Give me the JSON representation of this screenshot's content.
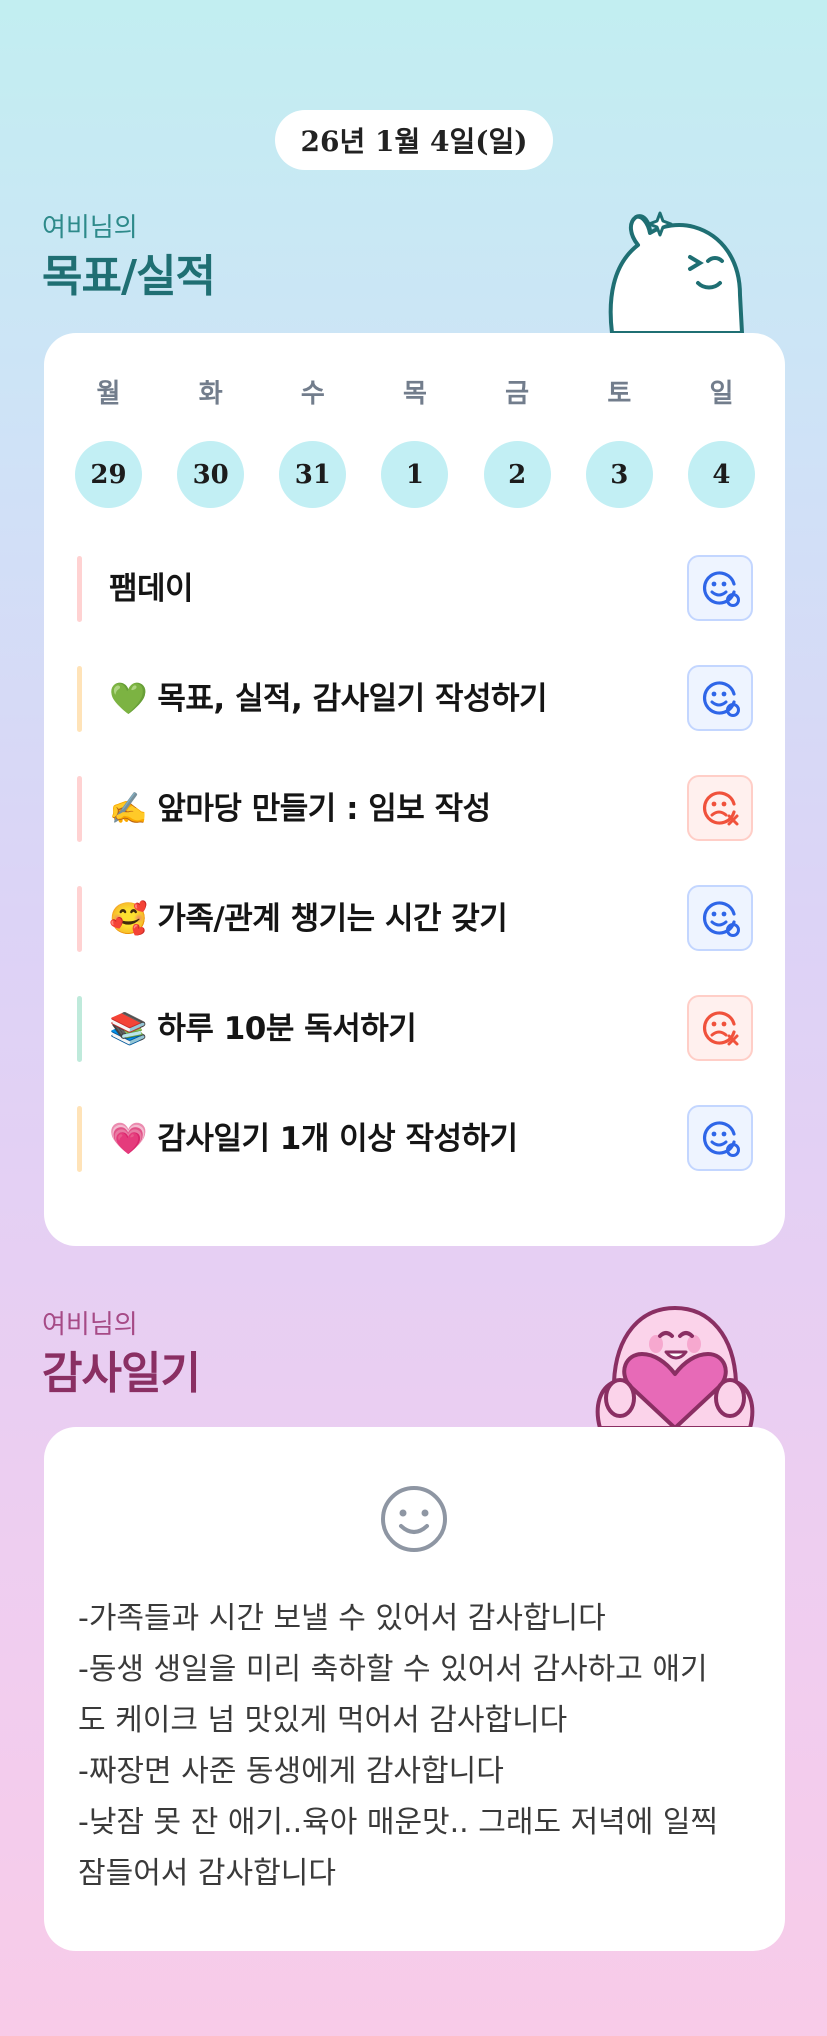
{
  "date": "26년 1월 4일(일)",
  "goals_section": {
    "subtitle": "여비님의",
    "title": "목표/실적"
  },
  "weekdays": [
    "월",
    "화",
    "수",
    "목",
    "금",
    "토",
    "일"
  ],
  "dates": [
    "29",
    "30",
    "31",
    "1",
    "2",
    "3",
    "4"
  ],
  "goals": [
    {
      "label": "팸데이",
      "status": "done",
      "bar_color": "#ffd2d2"
    },
    {
      "label": "💚 목표, 실적, 감사일기 작성하기",
      "status": "done",
      "bar_color": "#ffe3b8"
    },
    {
      "label": "✍️ 앞마당 만들기 : 임보 작성",
      "status": "missed",
      "bar_color": "#ffd2d2"
    },
    {
      "label": "🥰 가족/관계 챙기는 시간 갖기",
      "status": "done",
      "bar_color": "#ffd2d2"
    },
    {
      "label": "📚 하루 10분 독서하기",
      "status": "missed",
      "bar_color": "#bfeadb"
    },
    {
      "label": "💗 감사일기 1개 이상 작성하기",
      "status": "done",
      "bar_color": "#ffe3b8"
    }
  ],
  "gratitude_section": {
    "subtitle": "여비님의",
    "title": "감사일기"
  },
  "gratitude_lines": [
    "-가족들과 시간 보낼 수 있어서 감사합니다",
    "-동생 생일을 미리 축하할 수 있어서 감사하고 애기",
    "도 케이크 넘 맛있게 먹어서 감사합니다",
    "-짜장면 사준 동생에게 감사합니다",
    "-낮잠 못 잔 애기..육아 매운맛.. 그래도 저녁에 일찍",
    "잠들어서 감사합니다"
  ],
  "colors": {
    "done_icon": "#2f66e8",
    "missed_icon": "#f0523c",
    "date_circle": "#c2eff4"
  },
  "icons": {
    "done": "smile-check-icon",
    "missed": "sad-x-icon",
    "gratitude": "smile-face-icon"
  }
}
